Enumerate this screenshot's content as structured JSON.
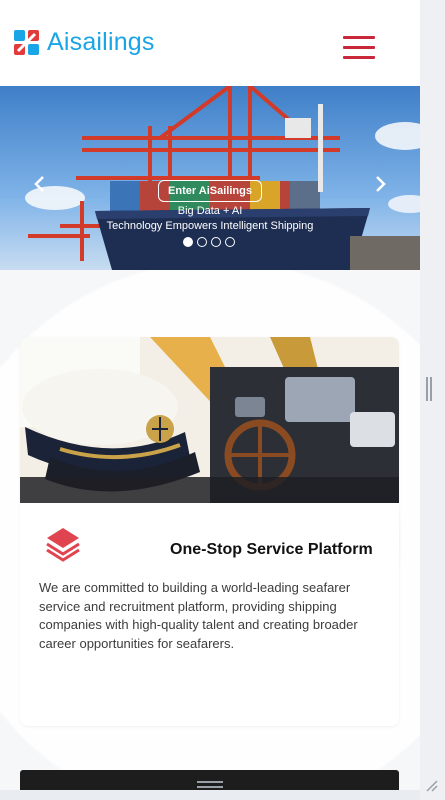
{
  "header": {
    "logo_text": "Aisailings",
    "logo_icon": "aisailings-logo-icon",
    "menu_icon": "hamburger-menu-icon",
    "brand_color": "#1aa5e6",
    "accent_color": "#c8283a"
  },
  "banner": {
    "button_label": "Enter AiSailings",
    "line1": "Big Data + AI",
    "line2": "Technology Empowers Intelligent Shipping",
    "prev_icon": "chevron-left-icon",
    "next_icon": "chevron-right-icon",
    "slide_count": 4,
    "active_slide": 1
  },
  "card": {
    "title": "One-Stop Service Platform",
    "icon": "layers-icon",
    "body": "We are committed to building a world-leading seafarer service and recruitment platform, providing shipping companies with high-quality talent and creating broader career opportunities for seafarers."
  }
}
